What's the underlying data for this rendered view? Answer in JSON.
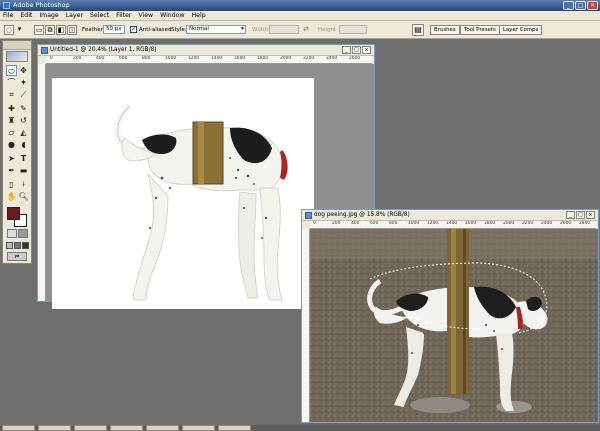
{
  "app": {
    "title": "Adobe Photoshop"
  },
  "menu": [
    "File",
    "Edit",
    "Image",
    "Layer",
    "Select",
    "Filter",
    "View",
    "Window",
    "Help"
  ],
  "options": {
    "feather_label": "Feather:",
    "feather_value": "50 px",
    "antialiased_label": "Anti-aliased",
    "antialiased_checked": true,
    "style_label": "Style:",
    "style_value": "Normal",
    "width_label": "Width:",
    "height_label": "Height:"
  },
  "palette_well": {
    "tabs": [
      "Brushes",
      "Tool Presets",
      "Layer Comps"
    ]
  },
  "doc1": {
    "title": "Untitled-1 @ 20.4% (Layer 1, RGB/8)",
    "ruler_ticks": [
      "0",
      "200",
      "400",
      "600",
      "800",
      "1000",
      "1200",
      "1400",
      "1600",
      "1800",
      "2000",
      "2200",
      "2400",
      "2600"
    ]
  },
  "doc2": {
    "title": "dog peeing.jpg @ 15.8% (RGB/8)",
    "ruler_ticks": [
      "0",
      "200",
      "400",
      "600",
      "800",
      "1000",
      "1200",
      "1400",
      "1600",
      "1800",
      "2000",
      "2200",
      "2400",
      "2600",
      "2800"
    ]
  },
  "colors": {
    "foreground": "#6b1a1c",
    "background": "#ffffff",
    "titlebar": "#24467e"
  }
}
